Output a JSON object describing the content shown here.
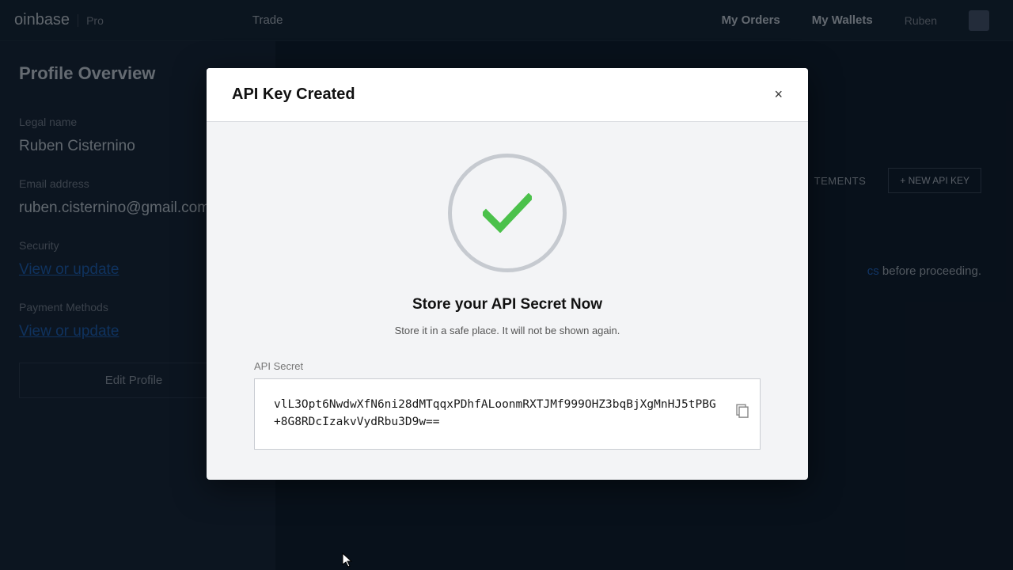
{
  "header": {
    "brand_main": "oinbase",
    "brand_sub": "Pro",
    "trade": "Trade",
    "my_orders": "My Orders",
    "my_wallets": "My Wallets",
    "username": "Ruben"
  },
  "sidebar": {
    "title": "Profile Overview",
    "legal_name_label": "Legal name",
    "legal_name_value": "Ruben Cisternino",
    "email_label": "Email address",
    "email_value": "ruben.cisternino@gmail.com",
    "security_label": "Security",
    "security_link": "View or update",
    "payment_label": "Payment Methods",
    "payment_link": "View or update",
    "edit_button": "Edit Profile"
  },
  "main": {
    "tab_statements": "TEMENTS",
    "new_api_key": "+ NEW API KEY",
    "notice_suffix": " before proceeding.",
    "notice_link_tail": "cs"
  },
  "modal": {
    "title": "API Key Created",
    "close": "×",
    "store_title": "Store your API Secret Now",
    "store_sub": "Store it in a safe place. It will not be shown again.",
    "secret_label": "API Secret",
    "secret_value": "vlL3Opt6NwdwXfN6ni28dMTqqxPDhfALoonmRXTJMf999OHZ3bqBjXgMnHJ5tPBG+8G8RDcIzakvVydRbu3D9w=="
  }
}
